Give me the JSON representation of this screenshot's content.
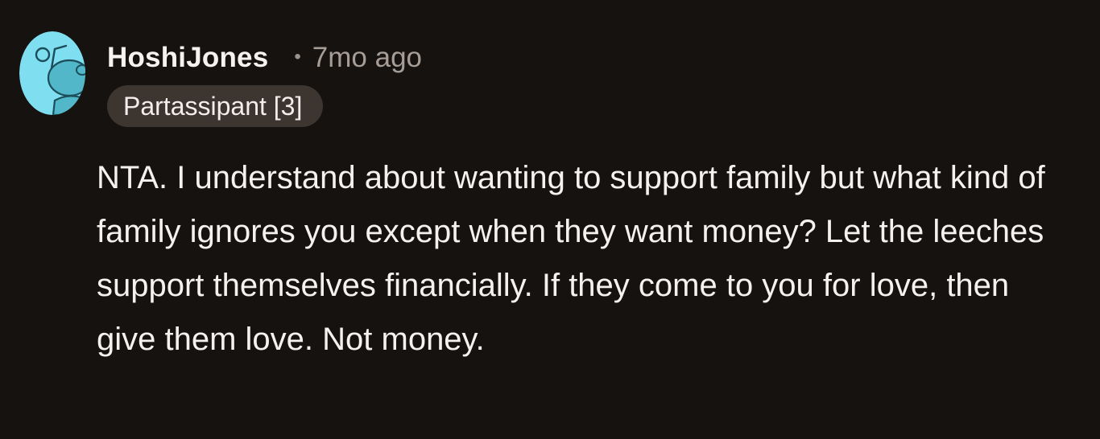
{
  "comment": {
    "username": "HoshiJones",
    "separator": "•",
    "timestamp": "7mo ago",
    "flair": "Partassipant [3]",
    "avatar_icon": "snoo-avatar-icon",
    "body": "NTA. I understand about wanting to support family but what kind of family ignores you except when they want money? Let the leeches support themselves financially. If they come to you for love, then give them love. Not money."
  },
  "colors": {
    "background": "#161210",
    "avatar_background": "#7fdff0",
    "flair_background": "#3d3530",
    "text_primary": "#f4f2f0",
    "text_muted": "#a59d96"
  }
}
